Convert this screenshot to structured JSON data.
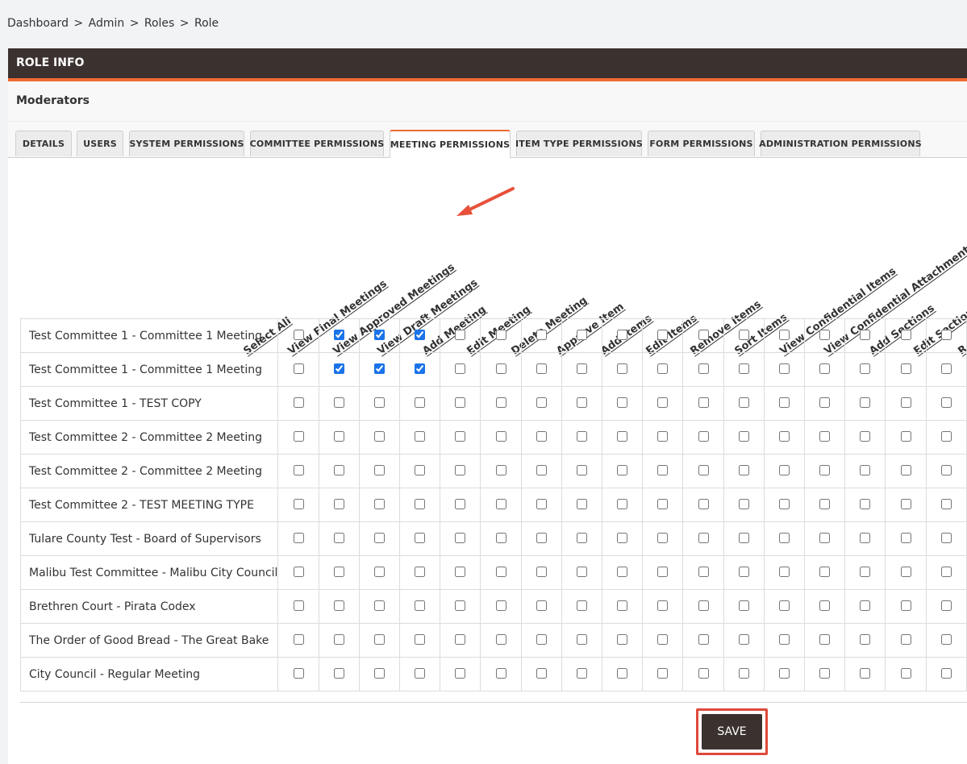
{
  "breadcrumb": {
    "items": [
      "Dashboard",
      "Admin",
      "Roles",
      "Role"
    ],
    "separator": ">"
  },
  "card": {
    "title": "ROLE INFO",
    "role_name": "Moderators"
  },
  "tabs": [
    {
      "label": "DETAILS",
      "active": false
    },
    {
      "label": "USERS",
      "active": false
    },
    {
      "label": "SYSTEM PERMISSIONS",
      "active": false
    },
    {
      "label": "COMMITTEE PERMISSIONS",
      "active": false
    },
    {
      "label": "MEETING PERMISSIONS",
      "active": true
    },
    {
      "label": "ITEM TYPE PERMISSIONS",
      "active": false
    },
    {
      "label": "FORM PERMISSIONS",
      "active": false
    },
    {
      "label": "ADMINISTRATION PERMISSIONS",
      "active": false
    }
  ],
  "columns": [
    "Select All",
    "View Final Meetings",
    "View Approved Meetings",
    "View Draft Meetings",
    "Add Meeting",
    "Edit Meeting",
    "Delete Meeting",
    "Approve Item",
    "Add Items",
    "Edit Items",
    "Remove Items",
    "Sort Items",
    "View Confidential Items",
    "View Confidential Attachments",
    "Add Sections",
    "Edit Sections",
    "R"
  ],
  "rows": [
    {
      "name": "Test Committee 1 - Committee 1 Meeting",
      "checked": [
        false,
        true,
        true,
        true,
        false,
        false,
        false,
        false,
        false,
        false,
        false,
        false,
        false,
        false,
        false,
        false,
        false
      ]
    },
    {
      "name": "Test Committee 1 - Committee 1 Meeting",
      "checked": [
        false,
        true,
        true,
        true,
        false,
        false,
        false,
        false,
        false,
        false,
        false,
        false,
        false,
        false,
        false,
        false,
        false
      ]
    },
    {
      "name": "Test Committee 1 - TEST COPY",
      "checked": [
        false,
        false,
        false,
        false,
        false,
        false,
        false,
        false,
        false,
        false,
        false,
        false,
        false,
        false,
        false,
        false,
        false
      ]
    },
    {
      "name": "Test Committee 2 - Committee 2 Meeting",
      "checked": [
        false,
        false,
        false,
        false,
        false,
        false,
        false,
        false,
        false,
        false,
        false,
        false,
        false,
        false,
        false,
        false,
        false
      ]
    },
    {
      "name": "Test Committee 2 - Committee 2 Meeting",
      "checked": [
        false,
        false,
        false,
        false,
        false,
        false,
        false,
        false,
        false,
        false,
        false,
        false,
        false,
        false,
        false,
        false,
        false
      ]
    },
    {
      "name": "Test Committee 2 - TEST MEETING TYPE",
      "checked": [
        false,
        false,
        false,
        false,
        false,
        false,
        false,
        false,
        false,
        false,
        false,
        false,
        false,
        false,
        false,
        false,
        false
      ]
    },
    {
      "name": "Tulare County Test - Board of Supervisors",
      "checked": [
        false,
        false,
        false,
        false,
        false,
        false,
        false,
        false,
        false,
        false,
        false,
        false,
        false,
        false,
        false,
        false,
        false
      ]
    },
    {
      "name": "Malibu Test Committee - Malibu City Council",
      "checked": [
        false,
        false,
        false,
        false,
        false,
        false,
        false,
        false,
        false,
        false,
        false,
        false,
        false,
        false,
        false,
        false,
        false
      ]
    },
    {
      "name": "Brethren Court - Pirata Codex",
      "checked": [
        false,
        false,
        false,
        false,
        false,
        false,
        false,
        false,
        false,
        false,
        false,
        false,
        false,
        false,
        false,
        false,
        false
      ]
    },
    {
      "name": "The Order of Good Bread - The Great Bake",
      "checked": [
        false,
        false,
        false,
        false,
        false,
        false,
        false,
        false,
        false,
        false,
        false,
        false,
        false,
        false,
        false,
        false,
        false
      ]
    },
    {
      "name": "City Council - Regular Meeting",
      "checked": [
        false,
        false,
        false,
        false,
        false,
        false,
        false,
        false,
        false,
        false,
        false,
        false,
        false,
        false,
        false,
        false,
        false
      ]
    }
  ],
  "save_label": "SAVE",
  "colors": {
    "header_bg": "#3b3230",
    "accent": "#ef6a32",
    "highlight": "#e0493a",
    "checkbox": "#1a73e8"
  },
  "icons": {
    "annotation": "red-arrow-icon"
  }
}
